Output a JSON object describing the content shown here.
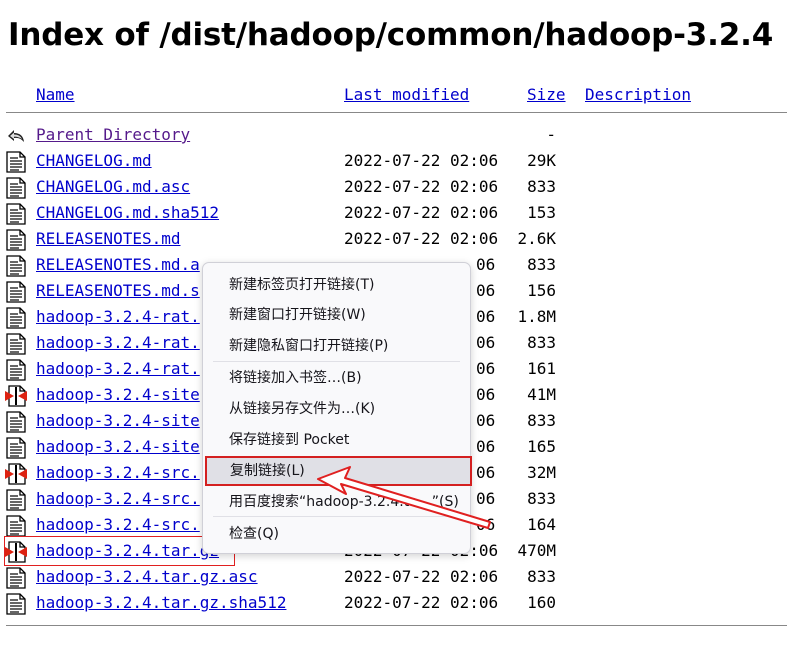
{
  "page": {
    "title": "Index of /dist/hadoop/common/hadoop-3.2.4"
  },
  "columns": {
    "name": "Name",
    "last_modified": "Last modified",
    "size": "Size",
    "description": "Description"
  },
  "rows": [
    {
      "icon": "back-icon",
      "name": "Parent Directory",
      "date": "",
      "size": "-"
    },
    {
      "icon": "text-file-icon",
      "name": "CHANGELOG.md",
      "date": "2022-07-22 02:06",
      "size": "29K"
    },
    {
      "icon": "text-file-icon",
      "name": "CHANGELOG.md.asc",
      "date": "2022-07-22 02:06",
      "size": "833"
    },
    {
      "icon": "text-file-icon",
      "name": "CHANGELOG.md.sha512",
      "date": "2022-07-22 02:06",
      "size": "153"
    },
    {
      "icon": "text-file-icon",
      "name": "RELEASENOTES.md",
      "date": "2022-07-22 02:06",
      "size": "2.6K"
    },
    {
      "icon": "text-file-icon",
      "name": "RELEASENOTES.md.a",
      "date": "06",
      "size": "833"
    },
    {
      "icon": "text-file-icon",
      "name": "RELEASENOTES.md.s",
      "date": "06",
      "size": "156"
    },
    {
      "icon": "text-file-icon",
      "name": "hadoop-3.2.4-rat.",
      "date": "06",
      "size": "1.8M"
    },
    {
      "icon": "text-file-icon",
      "name": "hadoop-3.2.4-rat.",
      "date": "06",
      "size": "833"
    },
    {
      "icon": "text-file-icon",
      "name": "hadoop-3.2.4-rat.",
      "date": "06",
      "size": "161"
    },
    {
      "icon": "archive-file-icon",
      "name": "hadoop-3.2.4-site",
      "date": "06",
      "size": "41M"
    },
    {
      "icon": "text-file-icon",
      "name": "hadoop-3.2.4-site",
      "date": "06",
      "size": "833"
    },
    {
      "icon": "text-file-icon",
      "name": "hadoop-3.2.4-site",
      "date": "06",
      "size": "165"
    },
    {
      "icon": "archive-file-icon",
      "name": "hadoop-3.2.4-src.",
      "date": "06",
      "size": "32M"
    },
    {
      "icon": "text-file-icon",
      "name": "hadoop-3.2.4-src.",
      "date": "06",
      "size": "833"
    },
    {
      "icon": "text-file-icon",
      "name": "hadoop-3.2.4-src.",
      "date": "06",
      "size": "164"
    },
    {
      "icon": "archive-file-icon",
      "name": "hadoop-3.2.4.tar.gz",
      "date": "2022-07-22 02:06",
      "size": "470M"
    },
    {
      "icon": "text-file-icon",
      "name": "hadoop-3.2.4.tar.gz.asc",
      "date": "2022-07-22 02:06",
      "size": "833"
    },
    {
      "icon": "text-file-icon",
      "name": "hadoop-3.2.4.tar.gz.sha512",
      "date": "2022-07-22 02:06",
      "size": "160"
    }
  ],
  "context_menu": {
    "items": [
      "新建标签页打开链接(T)",
      "新建窗口打开链接(W)",
      "新建隐私窗口打开链接(P)",
      "将链接加入书签…(B)",
      "从链接另存文件为…(K)",
      "保存链接到 Pocket",
      "复制链接(L)",
      "用百度搜索“hadoop-3.2.4.ta…”(S)",
      "检查(Q)"
    ],
    "active_index": 6
  },
  "colors": {
    "link": "#0000cc",
    "visited_link": "#551a8b",
    "annotation": "#e02020"
  }
}
